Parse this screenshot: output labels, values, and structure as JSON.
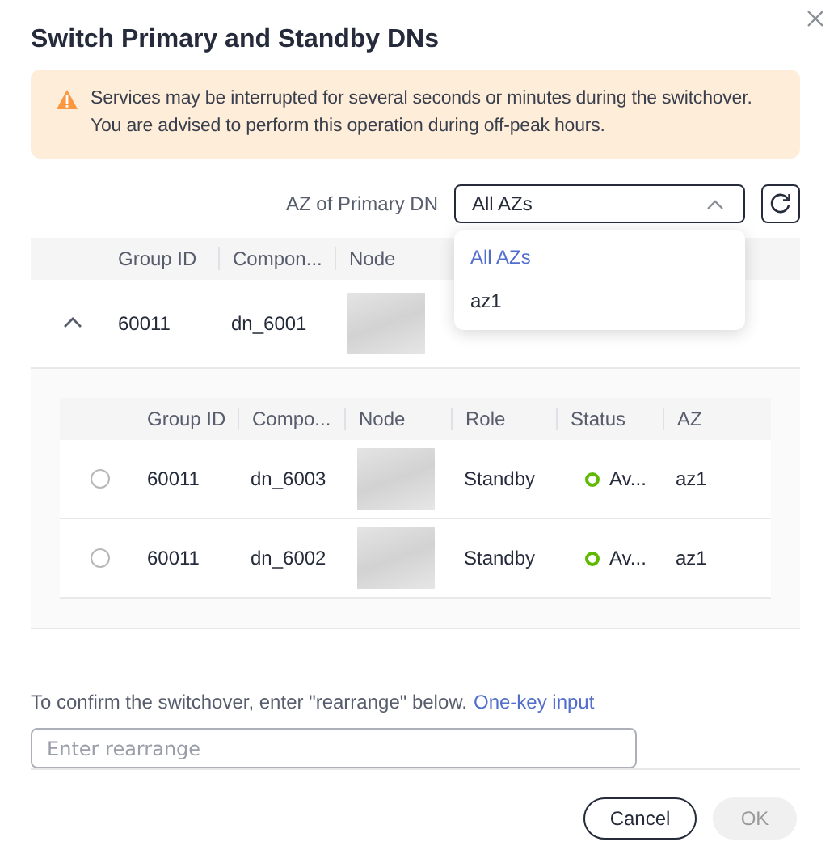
{
  "dialog": {
    "title": "Switch Primary and Standby DNs"
  },
  "alert": {
    "kind": "warning",
    "lines": [
      "Services may be interrupted for several seconds or minutes during the switchover.",
      "You are advised to perform this operation during off-peak hours."
    ]
  },
  "filter": {
    "label": "AZ of Primary DN",
    "value": "All AZs",
    "expanded": true,
    "options": [
      {
        "label": "All AZs",
        "selected": true
      },
      {
        "label": "az1",
        "selected": false
      }
    ]
  },
  "table": {
    "columns": [
      "Group ID",
      "Compon...",
      "Node"
    ],
    "rows": [
      {
        "expanded": true,
        "group_id": "60011",
        "component": "dn_6001",
        "node": {
          "kind": "redacted"
        },
        "children": {
          "columns": [
            "Group ID",
            "Compo...",
            "Node",
            "Role",
            "Status",
            "AZ"
          ],
          "rows": [
            {
              "selected": false,
              "group_id": "60011",
              "component": "dn_6003",
              "node": {
                "kind": "redacted"
              },
              "role": "Standby",
              "status": {
                "text": "Av...",
                "color": "#5dba00"
              },
              "az": "az1"
            },
            {
              "selected": false,
              "group_id": "60011",
              "component": "dn_6002",
              "node": {
                "kind": "redacted"
              },
              "role": "Standby",
              "status": {
                "text": "Av...",
                "color": "#5dba00"
              },
              "az": "az1"
            }
          ]
        }
      }
    ]
  },
  "confirm": {
    "text": "To confirm the switchover, enter \"rearrange\" below.",
    "link": "One-key input",
    "placeholder": "Enter rearrange"
  },
  "buttons": [
    {
      "label": "Cancel",
      "kind": "secondary",
      "disabled": false
    },
    {
      "label": "OK",
      "kind": "primary",
      "disabled": true
    }
  ]
}
